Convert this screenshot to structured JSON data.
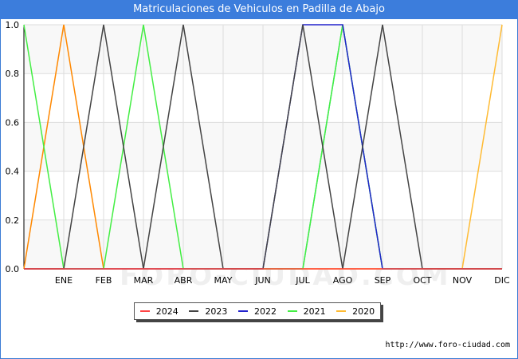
{
  "title": "Matriculaciones de Vehiculos en Padilla de Abajo",
  "watermark": "FORO-CIUDAD.COM",
  "url": "http://www.foro-ciudad.com",
  "chart_data": {
    "type": "line",
    "title": "Matriculaciones de Vehiculos en Padilla de Abajo",
    "xlabel": "",
    "ylabel": "",
    "categories": [
      "",
      "ENE",
      "FEB",
      "MAR",
      "ABR",
      "MAY",
      "JUN",
      "JUL",
      "AGO",
      "SEP",
      "OCT",
      "NOV",
      "DIC"
    ],
    "ylim": [
      0,
      1
    ],
    "yticks": [
      "0.0",
      "0.2",
      "0.4",
      "0.6",
      "0.8",
      "1.0"
    ],
    "grid": true,
    "legend_position": "bottom-center",
    "series": [
      {
        "name": "2024",
        "color": "#ff4444",
        "values": [
          0,
          0,
          0,
          0,
          0,
          0,
          0,
          0,
          0,
          0,
          0,
          0,
          0
        ]
      },
      {
        "name": "2023",
        "color": "#444444",
        "values": [
          0,
          0,
          1,
          0,
          1,
          0,
          0,
          1,
          0,
          1,
          0,
          0,
          0
        ]
      },
      {
        "name": "2022",
        "color": "#2222cc",
        "values": [
          0,
          0,
          0,
          0,
          0,
          0,
          0,
          1,
          1,
          0,
          0,
          0,
          0
        ]
      },
      {
        "name": "2021",
        "color": "#44ee44",
        "values": [
          1,
          0,
          0,
          1,
          0,
          0,
          0,
          0,
          1,
          0,
          0,
          0,
          0
        ]
      },
      {
        "name": "2020",
        "color": "#ffbb33",
        "values": [
          0,
          0,
          0,
          0,
          0,
          0,
          0,
          0,
          0,
          0,
          0,
          0,
          1
        ]
      },
      {
        "name": "",
        "color": "#ff8800",
        "values": [
          0,
          1,
          0,
          0,
          0,
          0,
          0,
          0,
          0,
          0,
          0,
          0,
          0
        ]
      },
      {
        "name": "",
        "color": "#22cc88",
        "values": [
          0,
          0,
          0,
          0,
          0,
          0,
          0,
          0,
          1,
          0,
          0,
          0,
          0
        ]
      }
    ]
  }
}
